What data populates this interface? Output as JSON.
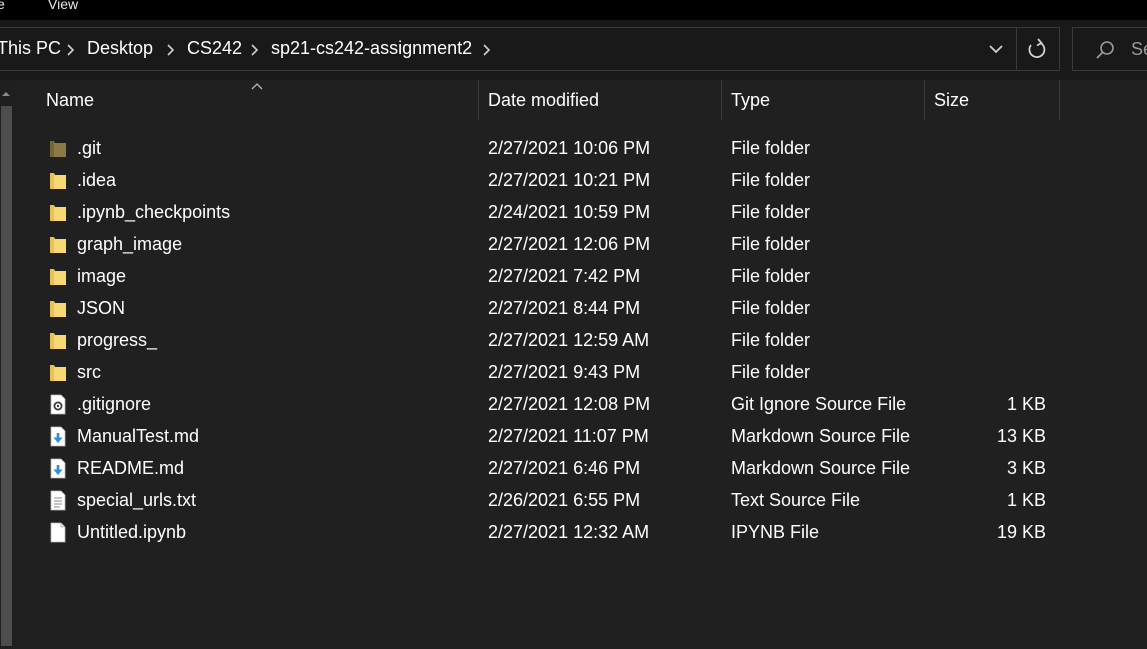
{
  "menubar": {
    "file_label": "e",
    "view_label": "View"
  },
  "address": {
    "crumbs": [
      "This PC",
      "Desktop",
      "CS242",
      "sp21-cs242-assignment2"
    ],
    "search_placeholder": "Se"
  },
  "columns": {
    "name": "Name",
    "date": "Date modified",
    "type": "Type",
    "size": "Size"
  },
  "files": [
    {
      "name": ".git",
      "date": "2/27/2021 10:06 PM",
      "type": "File folder",
      "size": "",
      "icon": "folder-dim-icon"
    },
    {
      "name": ".idea",
      "date": "2/27/2021 10:21 PM",
      "type": "File folder",
      "size": "",
      "icon": "folder-icon"
    },
    {
      "name": ".ipynb_checkpoints",
      "date": "2/24/2021 10:59 PM",
      "type": "File folder",
      "size": "",
      "icon": "folder-icon"
    },
    {
      "name": "graph_image",
      "date": "2/27/2021 12:06 PM",
      "type": "File folder",
      "size": "",
      "icon": "folder-icon"
    },
    {
      "name": "image",
      "date": "2/27/2021 7:42 PM",
      "type": "File folder",
      "size": "",
      "icon": "folder-icon"
    },
    {
      "name": "JSON",
      "date": "2/27/2021 8:44 PM",
      "type": "File folder",
      "size": "",
      "icon": "folder-icon"
    },
    {
      "name": "progress_",
      "date": "2/27/2021 12:59 AM",
      "type": "File folder",
      "size": "",
      "icon": "folder-icon"
    },
    {
      "name": "src",
      "date": "2/27/2021 9:43 PM",
      "type": "File folder",
      "size": "",
      "icon": "folder-icon"
    },
    {
      "name": ".gitignore",
      "date": "2/27/2021 12:08 PM",
      "type": "Git Ignore Source File",
      "size": "1 KB",
      "icon": "settings-file-icon"
    },
    {
      "name": "ManualTest.md",
      "date": "2/27/2021 11:07 PM",
      "type": "Markdown Source File",
      "size": "13 KB",
      "icon": "markdown-file-icon"
    },
    {
      "name": "README.md",
      "date": "2/27/2021 6:46 PM",
      "type": "Markdown Source File",
      "size": "3 KB",
      "icon": "markdown-file-icon"
    },
    {
      "name": "special_urls.txt",
      "date": "2/26/2021 6:55 PM",
      "type": "Text Source File",
      "size": "1 KB",
      "icon": "text-file-icon"
    },
    {
      "name": "Untitled.ipynb",
      "date": "2/27/2021 12:32 AM",
      "type": "IPYNB File",
      "size": "19 KB",
      "icon": "blank-file-icon"
    }
  ],
  "colors": {
    "folder": "#f8d775",
    "folder_dim": "#8c7a45",
    "markdown": "#2d8fd5",
    "text": "#ffffff",
    "border": "#3a3a3a"
  }
}
